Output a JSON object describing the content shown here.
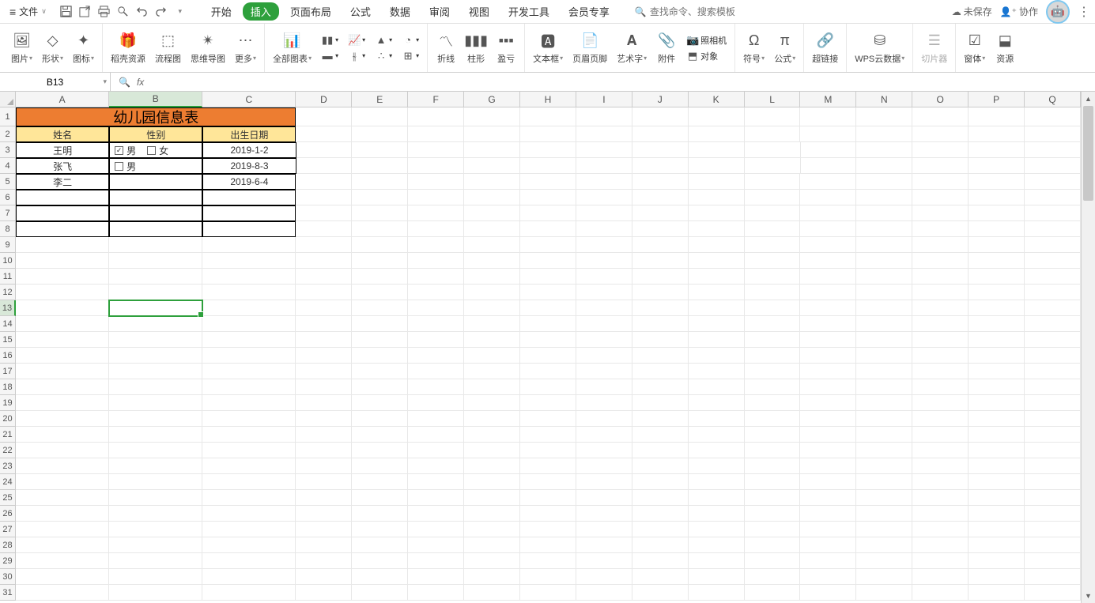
{
  "menubar": {
    "file_label": "文件",
    "tabs": [
      "开始",
      "插入",
      "页面布局",
      "公式",
      "数据",
      "审阅",
      "视图",
      "开发工具",
      "会员专享"
    ],
    "active_tab_index": 1,
    "search_placeholder": "查找命令、搜索模板",
    "unsaved": "未保存",
    "collab": "协作"
  },
  "ribbon": {
    "g1": {
      "pic": "图片",
      "shape": "形状",
      "icon": "图标"
    },
    "g2": {
      "docer": "稻壳资源",
      "flowchart": "流程图",
      "mindmap": "思维导图",
      "more": "更多"
    },
    "g3": {
      "allchart": "全部图表"
    },
    "g4": {
      "sparkline": "折线",
      "bar": "柱形",
      "winloss": "盈亏"
    },
    "g5": {
      "textbox": "文本框",
      "headerfooter": "页眉页脚",
      "wordart": "艺术字",
      "attach": "附件",
      "object": "对象",
      "camera": "照相机"
    },
    "g6": {
      "symbol": "符号",
      "formula": "公式"
    },
    "g7": {
      "hyperlink": "超链接"
    },
    "g8": {
      "wpscloud": "WPS云数据"
    },
    "g9": {
      "slicer": "切片器"
    },
    "g10": {
      "form": "窗体",
      "resource": "资源"
    }
  },
  "formula_bar": {
    "name_box": "B13",
    "fx_label": "fx"
  },
  "columns": [
    "A",
    "B",
    "C",
    "D",
    "E",
    "F",
    "G",
    "H",
    "I",
    "J",
    "K",
    "L",
    "M",
    "N",
    "O",
    "P",
    "Q"
  ],
  "col_widths": {
    "A": 120,
    "B": 120,
    "C": 120,
    "default": 72
  },
  "selected_cell": {
    "row": 13,
    "col": "B"
  },
  "sheet": {
    "title": "幼儿园信息表",
    "headers": {
      "name": "姓名",
      "gender": "性别",
      "dob": "出生日期"
    },
    "rows": [
      {
        "name": "王明",
        "gender_checks": [
          {
            "label": "男",
            "checked": true
          },
          {
            "label": "女",
            "checked": false
          }
        ],
        "dob": "2019-1-2"
      },
      {
        "name": "张飞",
        "gender_checks": [
          {
            "label": "男",
            "checked": false
          }
        ],
        "dob": "2019-8-3"
      },
      {
        "name": "李二",
        "gender_checks": [],
        "dob": "2019-6-4"
      }
    ]
  }
}
